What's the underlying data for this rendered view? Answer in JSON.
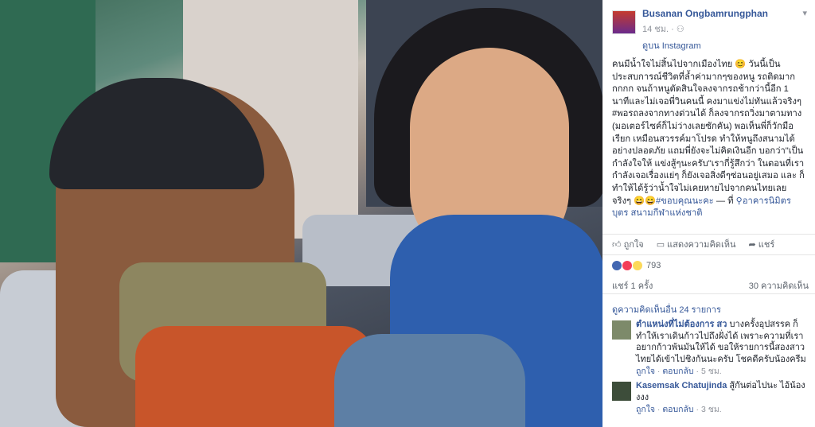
{
  "post": {
    "author": "Busanan Ongbamrungphan",
    "time": "14 ชม.",
    "via_label": "ดูบน Instagram",
    "text_prefix": "คนมีน้ำใจไม่สิ้นไปจากเมืองไทย 😊 วันนี้เป็นประสบการณ์ชีวิตที่ล้ำค่ามากๆของหนู รถติดมากกกกก จนถ้าหนูตัดสินใจลงจากรถช้ากว่านี้อีก 1 นาทีและไม่เจอพี่วินคนนี้ คงมาแข่งไม่ทันแล้วจริงๆ #พอรถลงจากทางด่วนได้ ก็ลงจากรถวิ่งมาตามทาง (มอเตอร์ไซค์ก็ไม่ว่างเลยซักคัน) พอเห็นพี่ก็วักมือเรียก เหมือนสวรรค์มาโปรด ทำให้หนูถึงสนามได้อย่างปลอดภัย แถมพี่ยังจะไม่คิดเงินอีก บอกว่า\"เป็นกำลังใจให้ แข่งสู้ๆนะครับ\"เรากี่รู้สึกว่า ในตอนที่เรากำลังเจอเรื่องแย่ๆ ก็ยังเจอสิ่งดีๆซ่อนอยู่เสมอ และ ก็ทำให้ได้รู้ว่าน้ำใจไม่เคยหายไปจากคนไทยเลยจริงๆ 😄😄",
    "hashtag": "#ขอบคุณนะคะ",
    "place_prefix": " — ที่ ",
    "place": "อาคารนิมิตรบุตร สนามกีฬาแห่งชาติ"
  },
  "actions": {
    "like": "ถูกใจ",
    "comment": "แสดงความคิดเห็น",
    "share": "แชร์"
  },
  "reactions": {
    "count": "793"
  },
  "stats": {
    "shares": "แชร์ 1 ครั้ง",
    "comments": "30 ความคิดเห็น"
  },
  "view_more": "ดูความคิดเห็นอื่น 24 รายการ",
  "comments": [
    {
      "name": "ตำแหน่งที่ไม่ต้องการ สว",
      "text": "บางครั้งอุปสรรค ก็ทำให้เราเดินก้าวไปถึงฝั่งได้ เพราะความที่เราอยากก้าวพ้นมันให้ได้ ขอให้รายการนี้สองสาวไทยได้เข้าไปชิงกันนะครับ โชคดีครับน้องครีม",
      "like": "ถูกใจ",
      "reply": "ตอบกลับ",
      "time": "5 ชม."
    },
    {
      "name": "Kasemsak Chatujinda",
      "text": "สู้กันต่อไปนะ ไอ้น้องงงง",
      "like": "ถูกใจ",
      "reply": "ตอบกลับ",
      "time": "3 ชม."
    }
  ],
  "colors": {
    "link": "#365899",
    "muted": "#90949c",
    "like_blue": "#4267b2",
    "love_red": "#f33e58",
    "wow_yellow": "#fcd95a"
  }
}
